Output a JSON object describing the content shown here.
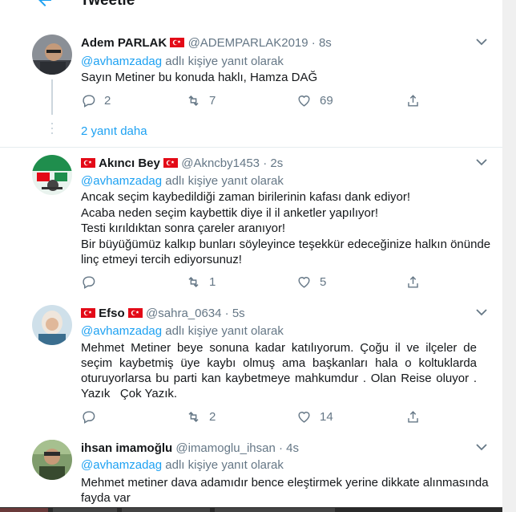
{
  "header": {
    "title": "Tweetle"
  },
  "tweets": [
    {
      "name": "Adem PARLAK",
      "handle": "@ADEMPARLAK2019",
      "separator": "·",
      "time": "8s",
      "mention": "@avhamzadag",
      "reply_suffix": " adlı kişiye yanıt olarak",
      "lines": [
        "Sayın Metiner bu konuda haklı, Hamza DAĞ"
      ],
      "replies": "2",
      "retweets": "7",
      "likes": "69"
    },
    {
      "name": "Akıncı Bey",
      "handle": "@Akncby1453",
      "separator": "·",
      "time": "2s",
      "mention": "@avhamzadag",
      "reply_suffix": " adlı kişiye yanıt olarak",
      "lines": [
        "Ancak seçim kaybedildiği zaman birilerinin kafası dank ediyor!",
        "Acaba neden seçim kaybettik diye il il anketler yapılıyor!",
        "Testi kırıldıktan sonra çareler aranıyor!",
        "Bir büyüğümüz kalkıp bunları söyleyince teşekkür edeceğinize halkın önünde",
        "linç etmeyi tercih ediyorsunuz!"
      ],
      "replies": "",
      "retweets": "1",
      "likes": "5"
    },
    {
      "name": "Efso",
      "handle": "@sahra_0634",
      "separator": "·",
      "time": "5s",
      "mention": "@avhamzadag",
      "reply_suffix": " adlı kişiye yanıt olarak",
      "lines": [
        "Mehmet Metiner beye sonuna kadar katılıyorum. Çoğu il ve ilçeler de",
        "seçim kaybetmiş üye kaybı olmuş ama başkanları hala o koltuklarda",
        "oturuyorlarsa bu parti kan kaybetmeye mahkumdur . Olan Reise oluyor .",
        "Yazık   Çok Yazık."
      ],
      "replies": "",
      "retweets": "2",
      "likes": "14"
    },
    {
      "name": "ihsan imamoğlu",
      "handle": "@imamoglu_ihsan",
      "separator": "·",
      "time": "4s",
      "mention": "@avhamzadag",
      "reply_suffix": " adlı kişiye yanıt olarak",
      "lines": [
        "Mehmet metiner dava adamıdır bence eleştirmek yerine dikkate alınmasında",
        "fayda var"
      ]
    }
  ],
  "more_replies": "2 yanıt daha",
  "colors": {
    "link": "#1da1f2",
    "muted": "#657786",
    "border": "#e6ecf0",
    "flag": "#e30a17"
  }
}
